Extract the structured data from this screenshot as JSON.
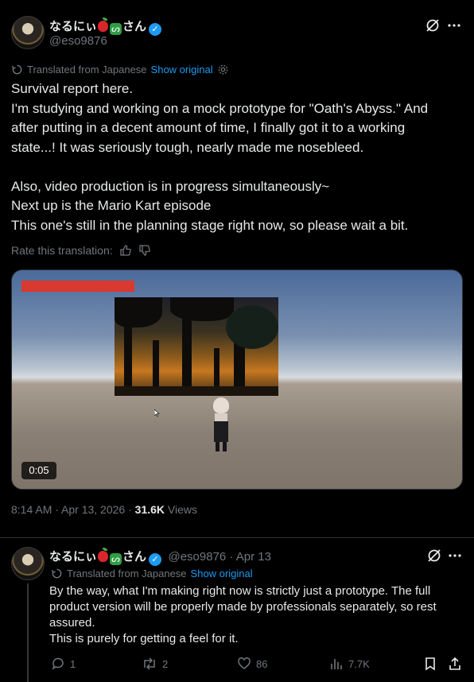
{
  "main_post": {
    "author_name": "なるにぃ",
    "author_name_suffix": "さん",
    "author_handle": "@eso9876",
    "translated_label": "Translated from Japanese",
    "show_original_label": "Show original",
    "body_lines": [
      "Survival report here.",
      "I'm studying and working on a mock prototype for \"Oath's Abyss.\" And",
      "after putting in a decent amount of time, I finally got it to a working",
      "state...! It was seriously tough, nearly made me nosebleed.",
      "",
      "Also, video production is in progress simultaneously~",
      "Next up is the Mario Kart episode",
      "This one's still in the planning stage right now, so please wait a bit."
    ],
    "rate_translation_label": "Rate this translation:",
    "video_time": "0:05",
    "timestamp": "8:14 AM · Apr 13, 2026 · ",
    "views_count": "31.6K",
    "views_label": " Views"
  },
  "reply_post": {
    "author_name": "なるにぃ",
    "author_name_suffix": "さん",
    "author_handle": "@eso9876",
    "date": " · Apr 13",
    "translated_label": "Translated from Japanese",
    "show_original_label": "Show original",
    "body_lines": [
      "By the way, what I'm making right now is strictly just a prototype. The full",
      "product version will be properly made by professionals separately, so rest",
      "assured.",
      "This is purely for getting a feel for it."
    ],
    "actions": {
      "replies": "1",
      "reposts": "2",
      "likes": "86",
      "views": "7.7K"
    }
  },
  "icons": {
    "verified": "verified-badge-icon",
    "grok": "grok-icon",
    "more": "more-icon",
    "settings": "gear-icon",
    "thumbs_up": "thumbs-up-icon",
    "thumbs_down": "thumbs-down-icon",
    "reply": "reply-icon",
    "repost": "repost-icon",
    "like": "heart-icon",
    "views": "views-icon",
    "bookmark": "bookmark-icon",
    "share": "share-icon"
  },
  "colors": {
    "background": "#000000",
    "text": "#e7e9ea",
    "muted": "#71767b",
    "link": "#1d9bf0",
    "verified": "#1d9bf0"
  }
}
